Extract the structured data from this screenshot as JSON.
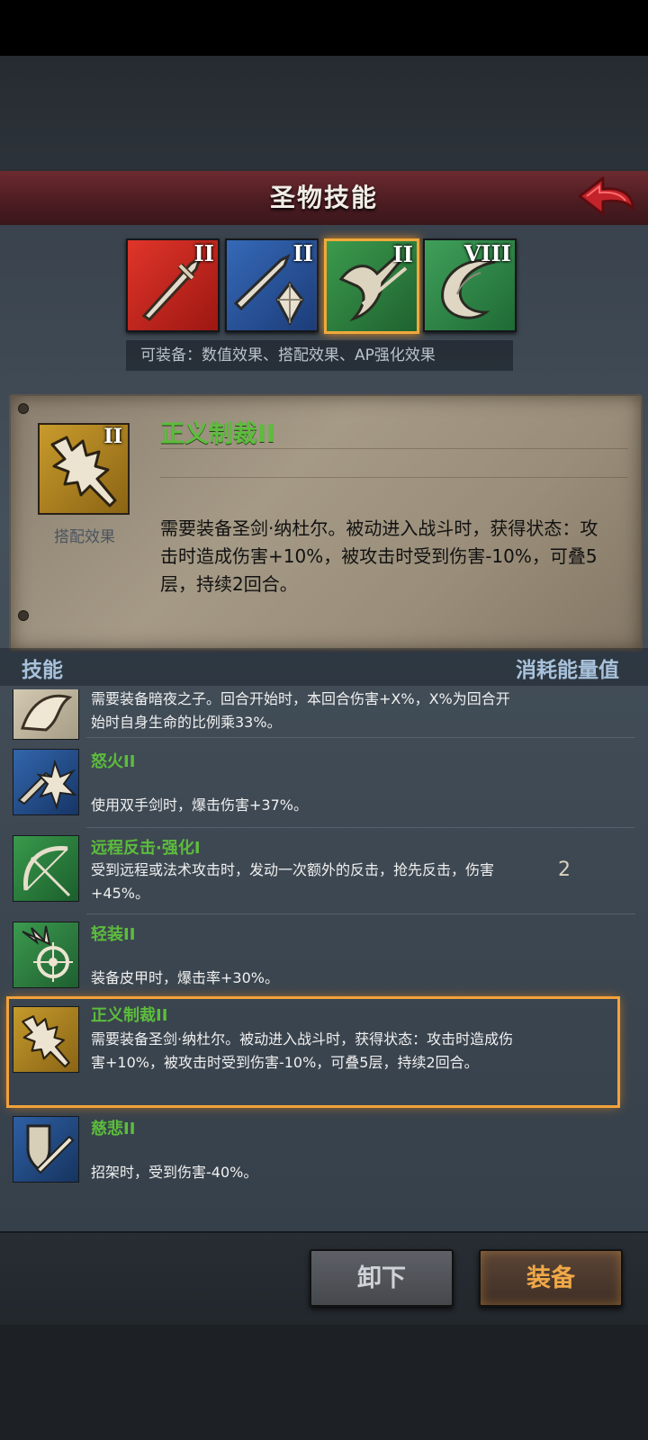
{
  "header": {
    "title": "圣物技能"
  },
  "relic_slots": [
    {
      "rank": "II",
      "icon": "red-sword-icon",
      "color": "#c8261e",
      "selected": false
    },
    {
      "rank": "II",
      "icon": "blue-sword-crystal-icon",
      "color": "#27529a",
      "selected": false
    },
    {
      "rank": "II",
      "icon": "green-bird-spear-icon",
      "color": "#2d7d3c",
      "selected": true
    },
    {
      "rank": "VIII",
      "icon": "green-horn-icon",
      "color": "#2f8a48",
      "selected": false
    }
  ],
  "equipable_note": "可装备：数值效果、搭配效果、AP强化效果",
  "detail": {
    "rank": "II",
    "badge": "搭配效果",
    "name": "正义制裁II",
    "description": "需要装备圣剑·纳杜尔。被动进入战斗时，获得状态：攻击时造成伤害+10%，被攻击时受到伤害-10%，可叠5层，持续2回合。"
  },
  "list_header": {
    "left": "技能",
    "right": "消耗能量值"
  },
  "skills": [
    {
      "name": "",
      "desc": "需要装备暗夜之子。回合开始时，本回合伤害+X%，X%为回合开始时自身生命的比例乘33%。",
      "cost": "",
      "icon": "cream-beast-icon",
      "selected": false
    },
    {
      "name": "怒火II",
      "desc": "使用双手剑时，爆击伤害+37%。",
      "cost": "",
      "icon": "blue-burst-sword-icon",
      "selected": false
    },
    {
      "name": "远程反击·强化I",
      "desc": "受到远程或法术攻击时，发动一次额外的反击，抢先反击，伤害+45%。",
      "cost": "2",
      "icon": "green-bow-icon",
      "selected": false
    },
    {
      "name": "轻装II",
      "desc": "装备皮甲时，爆击率+30%。",
      "cost": "",
      "icon": "green-target-icon",
      "selected": false
    },
    {
      "name": "正义制裁II",
      "desc": "需要装备圣剑·纳杜尔。被动进入战斗时，获得状态：攻击时造成伤害+10%，被攻击时受到伤害-10%，可叠5层，持续2回合。",
      "cost": "",
      "icon": "gold-holy-sword-icon",
      "selected": true
    },
    {
      "name": "慈悲II",
      "desc": "招架时，受到伤害-40%。",
      "cost": "",
      "icon": "blue-shield-sword-icon",
      "selected": false
    }
  ],
  "buttons": {
    "unequip": "卸下",
    "equip": "装备"
  }
}
